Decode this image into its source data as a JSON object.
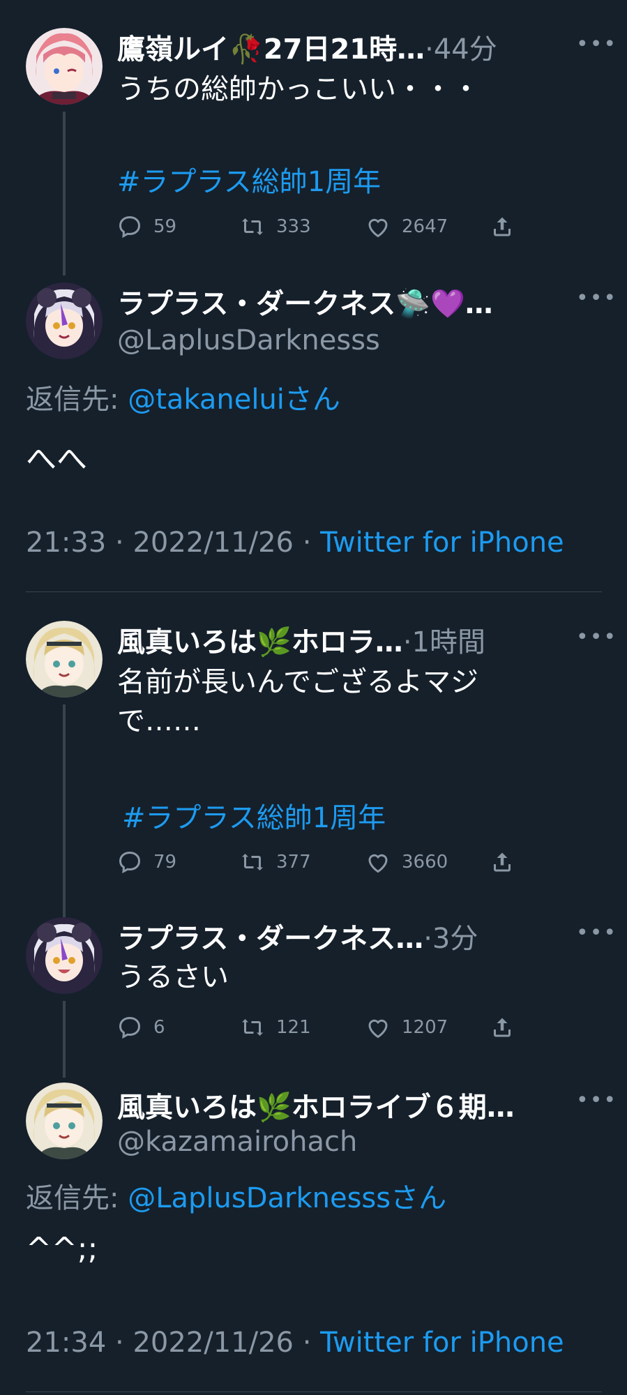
{
  "colors": {
    "background": "#15202b",
    "text": "#ffffff",
    "muted": "#8b98a5",
    "link": "#1d9bf0",
    "line": "#38444d"
  },
  "tweets": [
    {
      "name": "鷹嶺ルイ🥀27日21時…",
      "time": "·44分",
      "text": "うちの総帥かっこいい・・・",
      "hashtag": "#ラプラス総帥1周年",
      "replies": "59",
      "retweets": "333",
      "likes": "2647"
    },
    {
      "name": "ラプラス・ダークネス🛸💜…",
      "handle": "@LaplusDarknesss",
      "reply_label": "返信先: ",
      "reply_to": "@takaneluiさん",
      "text": "へへ",
      "time": "21:33",
      "date": "2022/11/26",
      "source": "Twitter for iPhone",
      "sep": " · "
    },
    {
      "name": "風真いろは🌿ホロラ…",
      "time": "·1時間",
      "text": "名前が長いんでござるよマジ\nで……",
      "hashtag": "#ラプラス総帥1周年",
      "replies": "79",
      "retweets": "377",
      "likes": "3660"
    },
    {
      "name": "ラプラス・ダークネス…",
      "time": "·3分",
      "text": "うるさい",
      "replies": "6",
      "retweets": "121",
      "likes": "1207"
    },
    {
      "name": "風真いろは🌿ホロライブ６期…",
      "handle": "@kazamairohach",
      "reply_label": "返信先: ",
      "reply_to": "@LaplusDarknesssさん",
      "text": "^^;;",
      "time": "21:34",
      "date": "2022/11/26",
      "source": "Twitter for iPhone",
      "sep": " · "
    }
  ],
  "icons": {
    "more": "more-icon",
    "reply": "reply-icon",
    "retweet": "retweet-icon",
    "like": "heart-icon",
    "share": "share-icon"
  }
}
